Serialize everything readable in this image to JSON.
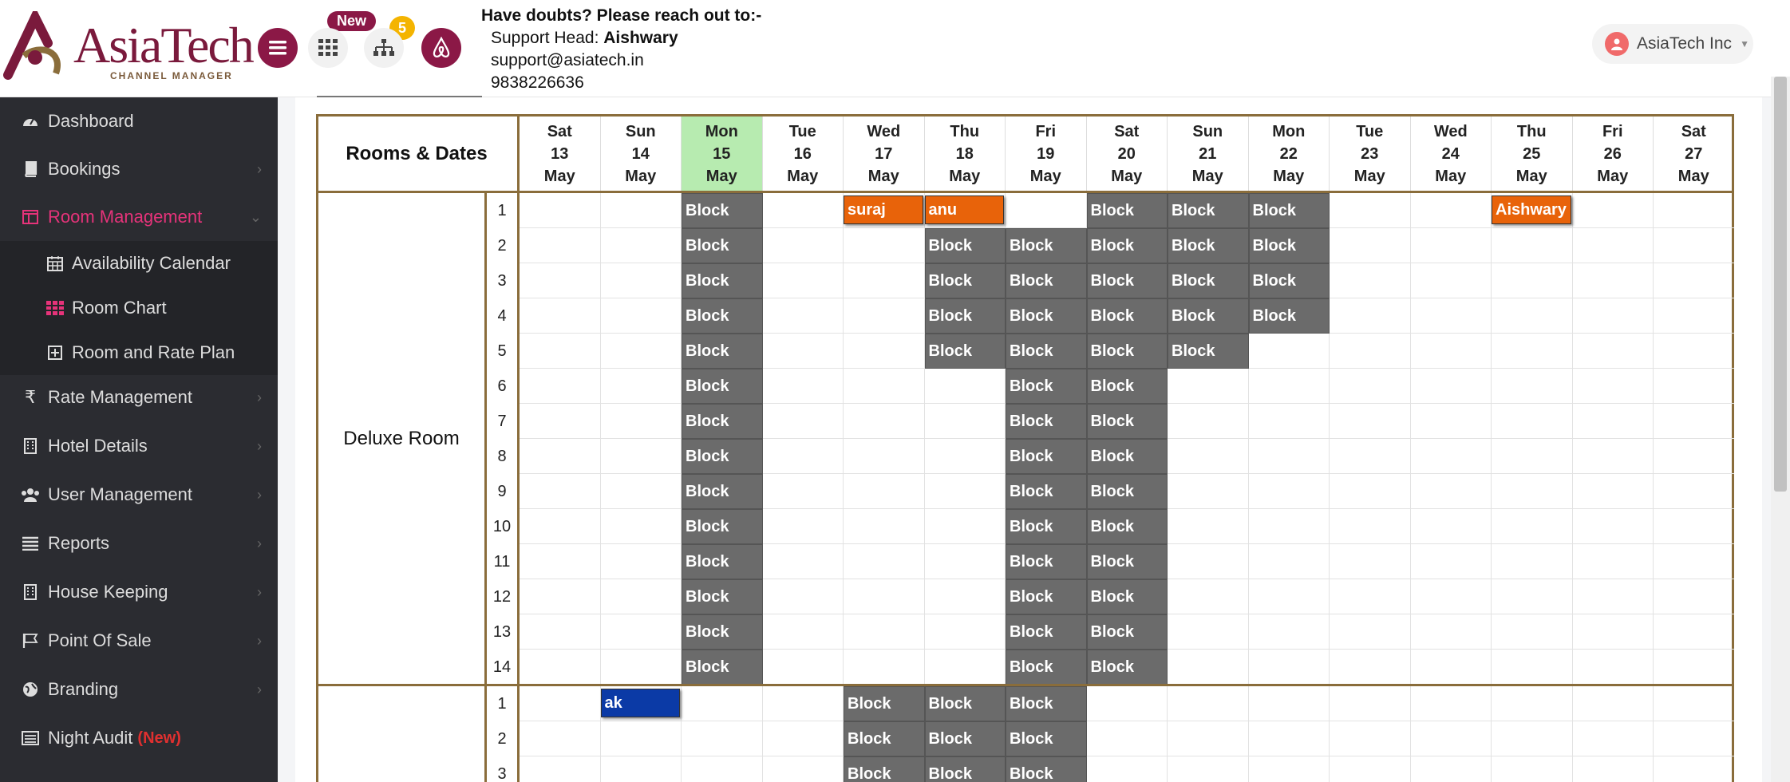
{
  "brand": {
    "name": "AsiaTech",
    "sub": "CHANNEL MANAGER"
  },
  "header": {
    "new_badge": "New",
    "count_badge": "5",
    "contact_title": "Have doubts? Please reach out to:-",
    "support_prefix": "Support Head: ",
    "support_name": "Aishwary",
    "email": "support@asiatech.in",
    "phone": "9838226636",
    "user": "AsiaTech Inc"
  },
  "sidebar": {
    "items": [
      {
        "label": "Dashboard",
        "icon": "dashboard-icon"
      },
      {
        "label": "Bookings",
        "icon": "book-icon"
      },
      {
        "label": "Room Management",
        "icon": "room-management-icon"
      },
      {
        "label": "Rate Management",
        "icon": "rupee-icon"
      },
      {
        "label": "Hotel Details",
        "icon": "building-icon"
      },
      {
        "label": "User Management",
        "icon": "users-icon"
      },
      {
        "label": "Reports",
        "icon": "reports-icon"
      },
      {
        "label": "House Keeping",
        "icon": "building-icon"
      },
      {
        "label": "Point Of Sale",
        "icon": "flag-icon"
      },
      {
        "label": "Branding",
        "icon": "globe-icon"
      },
      {
        "label": "Night Audit",
        "icon": "list-icon"
      }
    ],
    "sub_items": [
      {
        "label": "Availability Calendar",
        "icon": "calendar-icon"
      },
      {
        "label": "Room Chart",
        "icon": "grid-icon"
      },
      {
        "label": "Room and Rate Plan",
        "icon": "plus-square-icon"
      }
    ],
    "night_audit_tag": "(New)"
  },
  "chart": {
    "header_label": "Rooms & Dates",
    "dates": [
      {
        "dow": "Sat",
        "day": "13",
        "mon": "May"
      },
      {
        "dow": "Sun",
        "day": "14",
        "mon": "May"
      },
      {
        "dow": "Mon",
        "day": "15",
        "mon": "May",
        "today": true
      },
      {
        "dow": "Tue",
        "day": "16",
        "mon": "May"
      },
      {
        "dow": "Wed",
        "day": "17",
        "mon": "May"
      },
      {
        "dow": "Thu",
        "day": "18",
        "mon": "May"
      },
      {
        "dow": "Fri",
        "day": "19",
        "mon": "May"
      },
      {
        "dow": "Sat",
        "day": "20",
        "mon": "May"
      },
      {
        "dow": "Sun",
        "day": "21",
        "mon": "May"
      },
      {
        "dow": "Mon",
        "day": "22",
        "mon": "May"
      },
      {
        "dow": "Tue",
        "day": "23",
        "mon": "May"
      },
      {
        "dow": "Wed",
        "day": "24",
        "mon": "May"
      },
      {
        "dow": "Thu",
        "day": "25",
        "mon": "May"
      },
      {
        "dow": "Fri",
        "day": "26",
        "mon": "May"
      },
      {
        "dow": "Sat",
        "day": "27",
        "mon": "May"
      }
    ],
    "block_label": "Block",
    "room_types": [
      {
        "name": "Deluxe Room",
        "rows": [
          "1",
          "2",
          "3",
          "4",
          "5",
          "6",
          "7",
          "8",
          "9",
          "10",
          "11",
          "12",
          "13",
          "14"
        ],
        "blocks": [
          [
            2,
            7,
            8,
            9
          ],
          [
            2,
            5,
            6,
            7,
            8,
            9
          ],
          [
            2,
            5,
            6,
            7,
            8,
            9
          ],
          [
            2,
            5,
            6,
            7,
            8,
            9
          ],
          [
            2,
            5,
            6,
            7,
            8
          ],
          [
            2,
            6,
            7
          ],
          [
            2,
            6,
            7
          ],
          [
            2,
            6,
            7
          ],
          [
            2,
            6,
            7
          ],
          [
            2,
            6,
            7
          ],
          [
            2,
            6,
            7
          ],
          [
            2,
            6,
            7
          ],
          [
            2,
            6,
            7
          ],
          [
            2,
            6,
            7
          ]
        ],
        "bookings": [
          {
            "row": 0,
            "col": 4,
            "label": "suraj",
            "color": "#e8630a"
          },
          {
            "row": 0,
            "col": 5,
            "label": "anu",
            "color": "#e8630a"
          },
          {
            "row": 0,
            "col": 12,
            "label": "Aishwary",
            "color": "#e8630a"
          }
        ]
      },
      {
        "name": "",
        "rows": [
          "1",
          "2",
          "3"
        ],
        "blocks": [
          [
            4,
            5,
            6
          ],
          [
            4,
            5,
            6
          ],
          [
            4,
            5,
            6
          ]
        ],
        "bookings": [
          {
            "row": 0,
            "col": 1,
            "label": "ak",
            "color": "#0b3aa6"
          }
        ]
      }
    ]
  }
}
